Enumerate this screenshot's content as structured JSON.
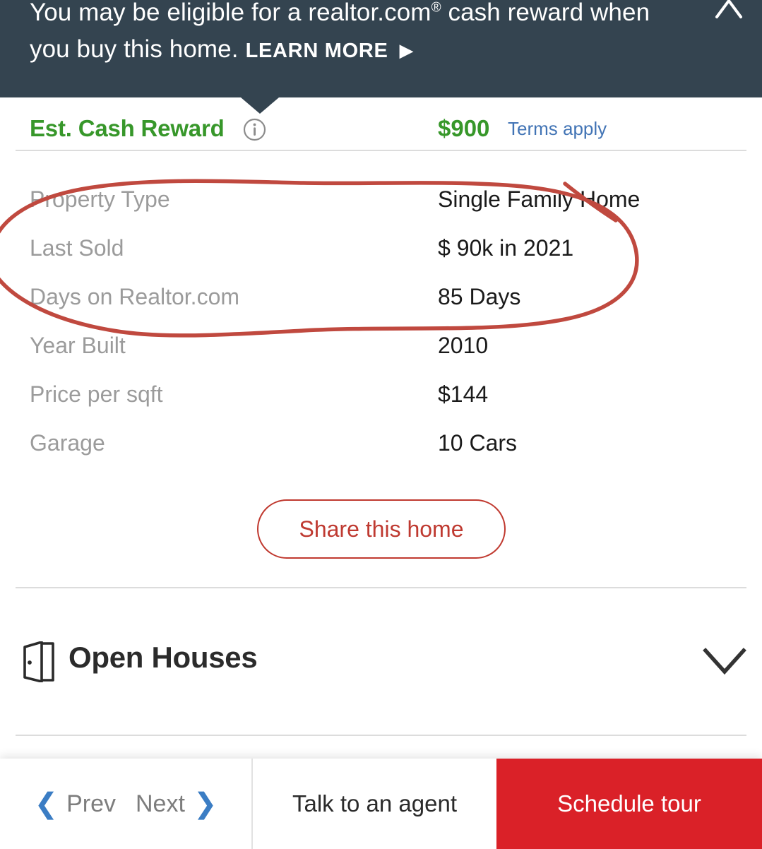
{
  "promo_banner": {
    "message_line1": "You may be eligible for a realtor.com",
    "registered_mark": "®",
    "message_line1_tail": " cash reward when",
    "message_line2": "you buy this home.",
    "learn_more_label": "LEARN MORE",
    "arrow_glyph": "▶",
    "close_icon": "close-icon",
    "background_color": "#344450"
  },
  "cash_reward": {
    "label": "Est. Cash Reward",
    "info_icon": "info-icon",
    "amount": "$900",
    "terms_link": "Terms apply",
    "amount_color": "#37972a",
    "link_color": "#4274b5"
  },
  "property_details": {
    "rows": [
      {
        "label": "Property Type",
        "value": "Single Family Home"
      },
      {
        "label": "Last Sold",
        "value": "$ 90k in 2021"
      },
      {
        "label": "Days on Realtor.com",
        "value": "85 Days"
      },
      {
        "label": "Year Built",
        "value": "2010"
      },
      {
        "label": "Price per sqft",
        "value": "$144"
      },
      {
        "label": "Garage",
        "value": "10 Cars"
      }
    ]
  },
  "annotation": {
    "type": "hand-drawn-red-circle",
    "color": "#c0493f",
    "encircles": [
      "Property Type",
      "Last Sold",
      "Days on Realtor.com"
    ]
  },
  "share": {
    "button_label": "Share this home",
    "accent_color": "#bf3a31"
  },
  "open_houses": {
    "title": "Open Houses",
    "door_icon": "open-door-icon",
    "expand_icon": "chevron-down-icon"
  },
  "bottom_bar": {
    "prev_label": "Prev",
    "next_label": "Next",
    "prev_chevron": "❮",
    "next_chevron": "❯",
    "agent_label": "Talk to an agent",
    "tour_label": "Schedule tour",
    "tour_color": "#da2128",
    "chevron_color": "#3b7dc4"
  }
}
